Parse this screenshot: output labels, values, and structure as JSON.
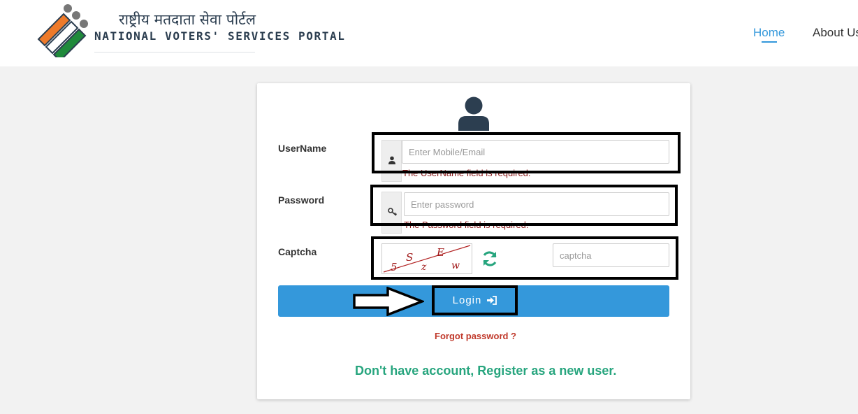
{
  "header": {
    "brand_hindi": "राष्ट्रीय मतदाता सेवा पोर्टल",
    "brand_english": "NATIONAL VOTERS' SERVICES PORTAL",
    "nav": {
      "home": "Home",
      "about": "About Us"
    }
  },
  "form": {
    "username": {
      "label": "UserName",
      "placeholder": "Enter Mobile/Email",
      "error": "The UserName field is required."
    },
    "password": {
      "label": "Password",
      "placeholder": "Enter password",
      "error": "The Password field is required."
    },
    "captcha": {
      "label": "Captcha",
      "placeholder": "captcha",
      "chars": [
        "5",
        "S",
        "z",
        "E",
        "w"
      ]
    },
    "login_label": "Login",
    "forgot_label": "Forgot password ?",
    "register_label": "Don't have account, Register as a new user."
  },
  "icons": {
    "user": "user-avatar-icon",
    "username_addon": "user-icon",
    "password_addon": "key-icon",
    "refresh": "refresh-icon",
    "login": "sign-in-icon"
  },
  "colors": {
    "primary": "#3498db",
    "error_text": "#8b1a1a",
    "forgot_link": "#c0392b",
    "register_link": "#27a57e",
    "heading": "#2c3e50"
  }
}
